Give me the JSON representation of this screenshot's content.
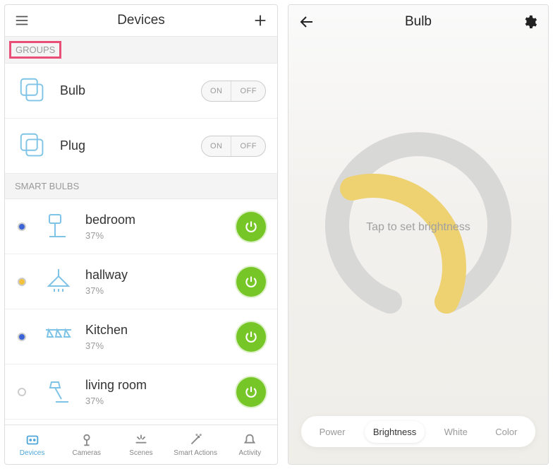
{
  "left": {
    "title": "Devices",
    "sections": {
      "groups_label": "GROUPS",
      "smart_bulbs_label": "SMART BULBS"
    },
    "groups": [
      {
        "name": "Bulb",
        "on_label": "ON",
        "off_label": "OFF"
      },
      {
        "name": "Plug",
        "on_label": "ON",
        "off_label": "OFF"
      }
    ],
    "bulbs": [
      {
        "name": "bedroom",
        "level": "37%",
        "status_color": "#3c64d6"
      },
      {
        "name": "hallway",
        "level": "37%",
        "status_color": "#f3c23c"
      },
      {
        "name": "Kitchen",
        "level": "37%",
        "status_color": "#3c64d6"
      },
      {
        "name": "living room",
        "level": "37%",
        "status_color": "#ffffff"
      }
    ],
    "tabs": [
      {
        "label": "Devices"
      },
      {
        "label": "Cameras"
      },
      {
        "label": "Scenes"
      },
      {
        "label": "Smart Actions"
      },
      {
        "label": "Activity"
      }
    ]
  },
  "right": {
    "title": "Bulb",
    "hint": "Tap to set brightness",
    "modes": [
      {
        "label": "Power"
      },
      {
        "label": "Brightness"
      },
      {
        "label": "White"
      },
      {
        "label": "Color"
      }
    ]
  }
}
